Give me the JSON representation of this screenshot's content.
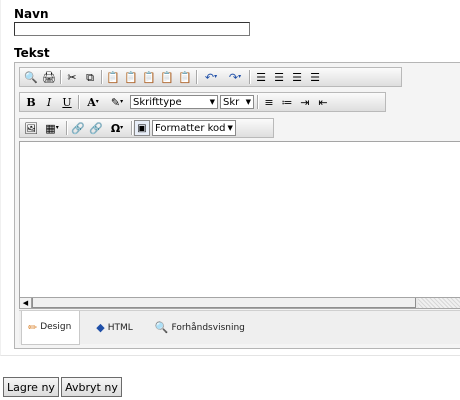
{
  "form": {
    "navn_label": "Navn",
    "navn_value": "",
    "tekst_label": "Tekst"
  },
  "toolbar": {
    "font_family_label": "Skrifttype",
    "font_size_label": "Skr",
    "format_code_label": "Formatter kod"
  },
  "modes": {
    "design": "Design",
    "html": "HTML",
    "preview": "Forhåndsvisning"
  },
  "buttons": {
    "save": "Lagre ny",
    "cancel": "Avbryt ny"
  },
  "colors": {
    "accent_blue": "#1f4fa8",
    "toolbar_bg": "#e6e6e6"
  }
}
